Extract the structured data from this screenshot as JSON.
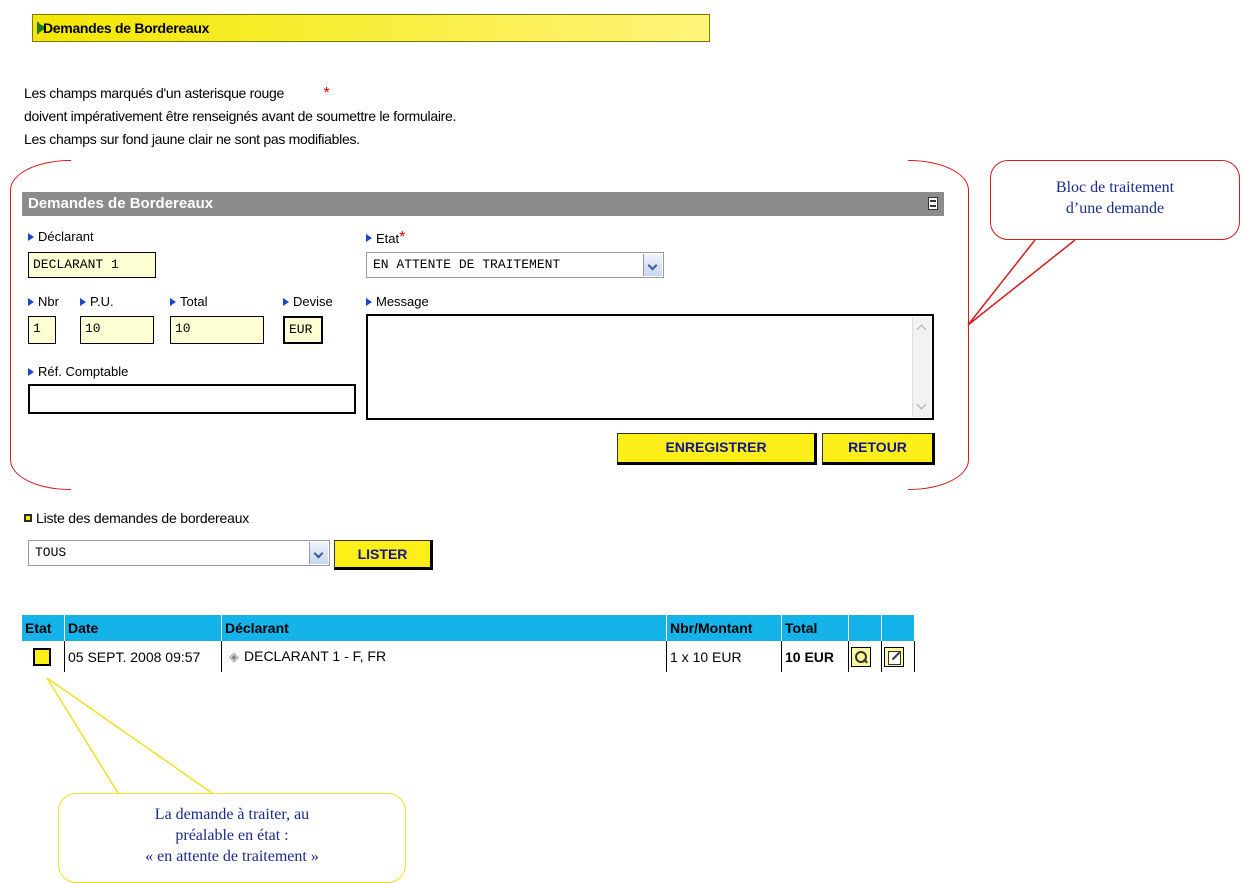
{
  "top_header": {
    "title": "Demandes de Bordereaux"
  },
  "intro": {
    "line1": "Les champs marqués d'un asterisque rouge",
    "required_marker": "*",
    "line2": "doivent impérativement être renseignés avant de soumettre le formulaire.",
    "line3": "Les champs sur fond jaune clair ne sont pas modifiables."
  },
  "panel": {
    "title": "Demandes de Bordereaux",
    "declarant": {
      "label": "Déclarant",
      "value": "DECLARANT 1"
    },
    "etat": {
      "label": "Etat",
      "required": "*",
      "value": "EN ATTENTE DE TRAITEMENT"
    },
    "nbr": {
      "label": "Nbr",
      "value": "1"
    },
    "pu": {
      "label": "P.U.",
      "value": "10"
    },
    "total": {
      "label": "Total",
      "value": "10"
    },
    "devise": {
      "label": "Devise",
      "value": "EUR"
    },
    "message": {
      "label": "Message",
      "value": ""
    },
    "ref_comptable": {
      "label": "Réf. Comptable",
      "value": ""
    },
    "save_label": "ENREGISTRER",
    "back_label": "RETOUR"
  },
  "list_section": {
    "title": "Liste des demandes de bordereaux",
    "filter_value": "TOUS",
    "list_label": "LISTER"
  },
  "table": {
    "headers": [
      "Etat",
      "Date",
      "Déclarant",
      "Nbr/Montant",
      "Total",
      "",
      ""
    ],
    "rows": [
      {
        "date": "05 SEPT. 2008 09:57",
        "declarant": "DECLARANT 1 - F, FR",
        "nbr_montant": "1 x 10 EUR",
        "total": "10 EUR"
      }
    ]
  },
  "callouts": {
    "block_line1": "Bloc de traitement",
    "block_line2": "d’une demande",
    "request_line1": "La demande à traiter, au",
    "request_line2": "préalable en état :",
    "request_line3": "« en attente de traitement »"
  },
  "colors": {
    "header_yellow": "#f4e600",
    "button_yellow": "#ffef18",
    "table_header_blue": "#14b4ea",
    "callout_red": "#d21d1d",
    "callout_yellow": "#f2df28",
    "panel_gray": "#8c8c8c"
  }
}
